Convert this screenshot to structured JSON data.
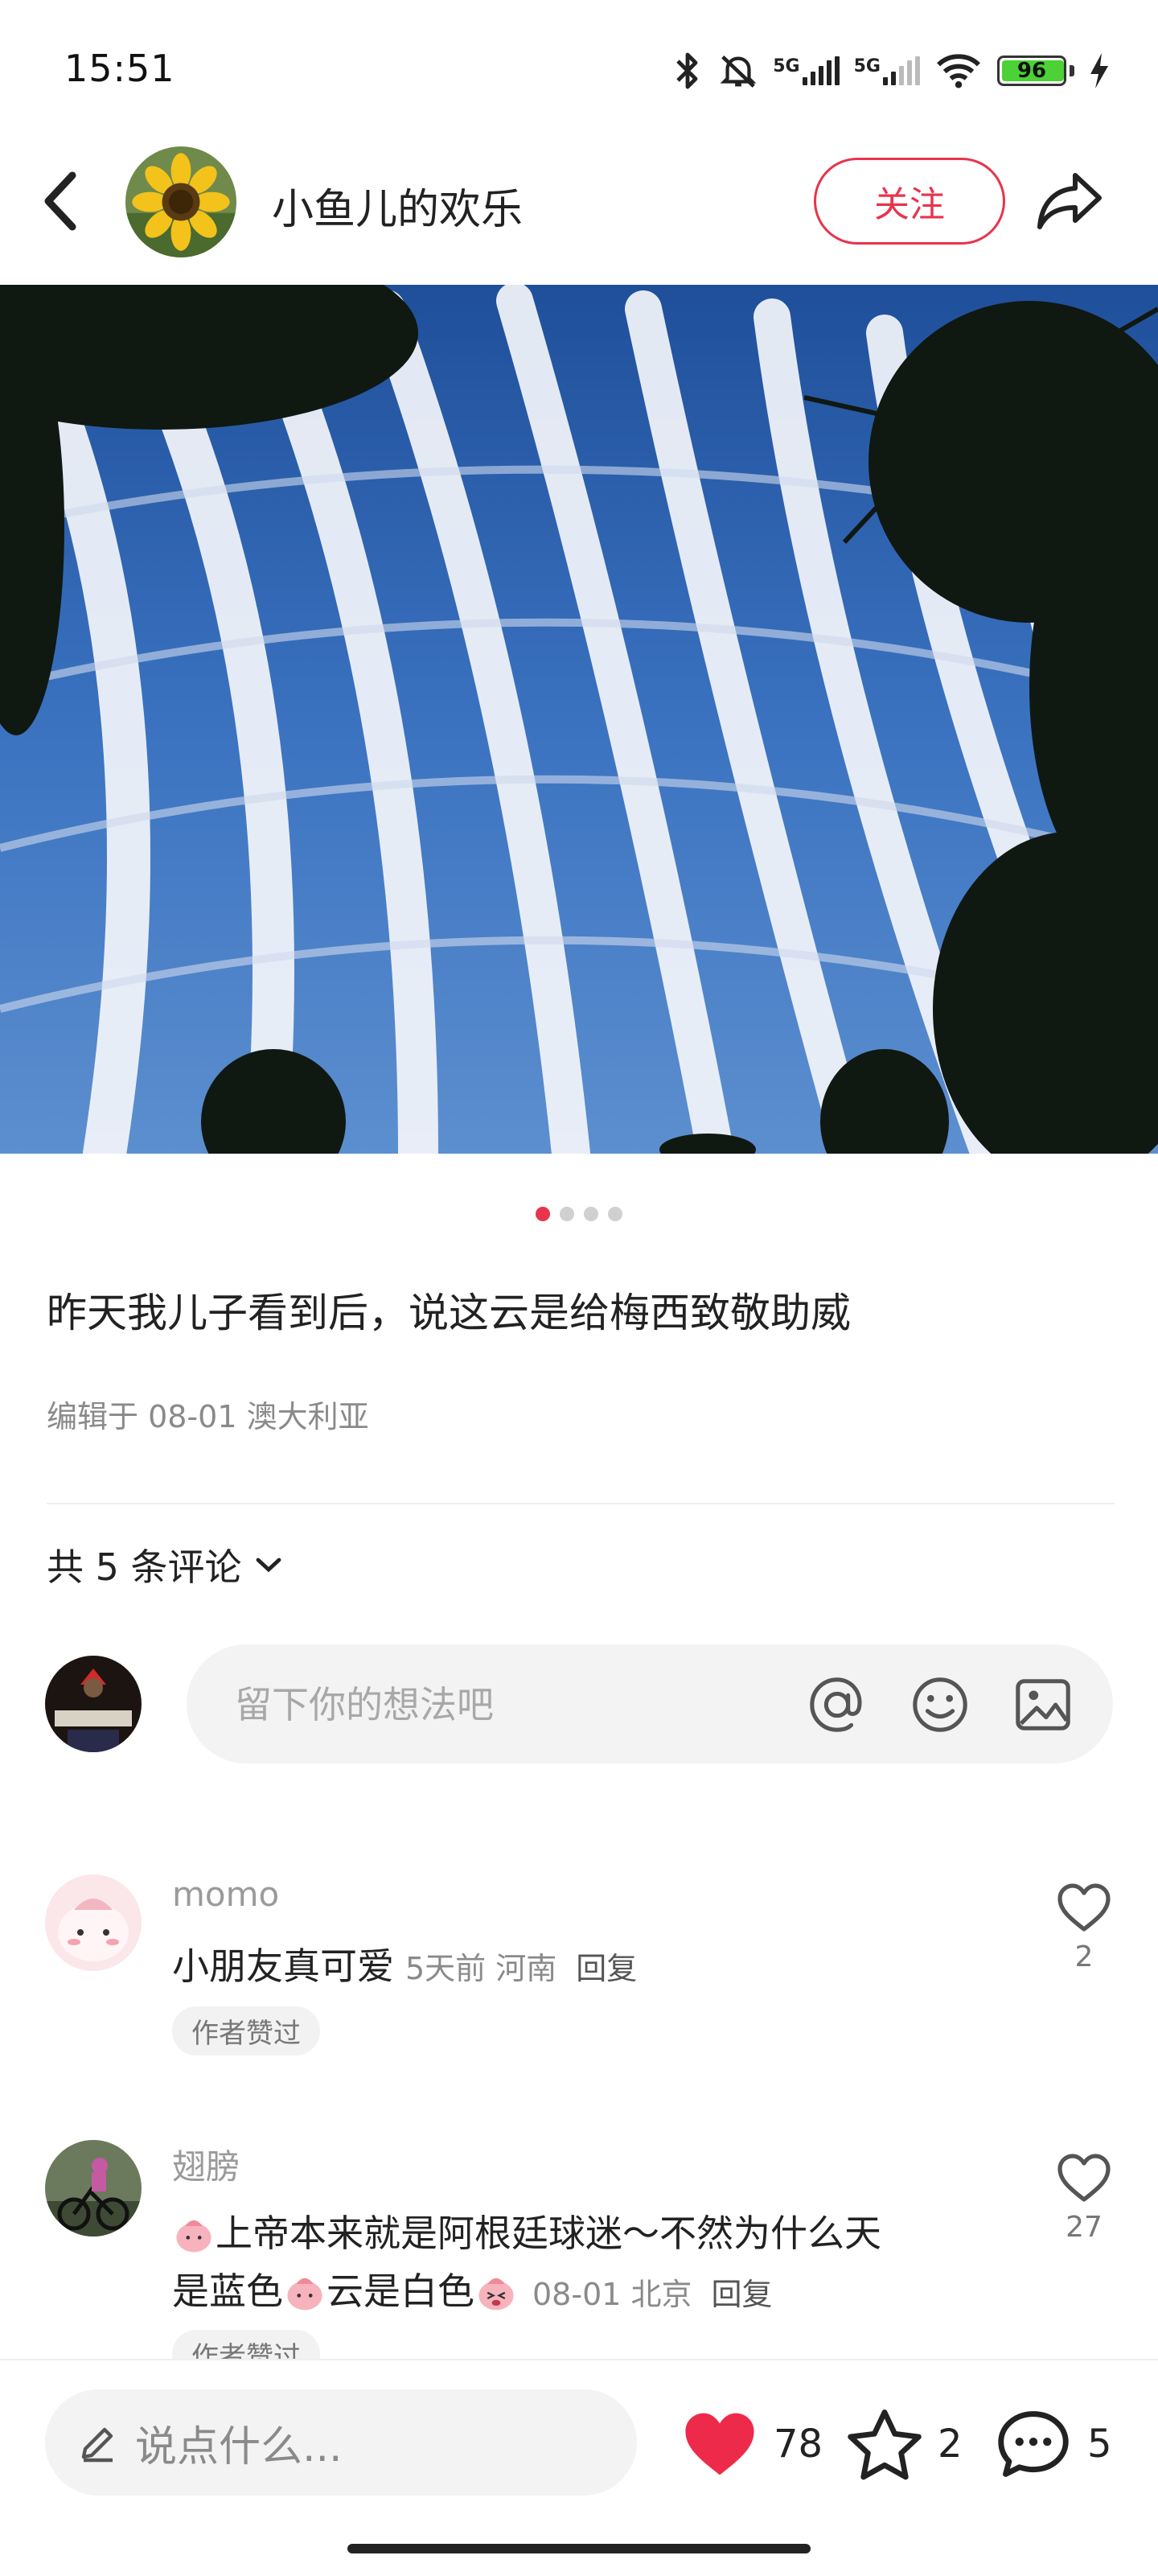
{
  "status_bar": {
    "time": "15:51",
    "battery": "96",
    "network_1": "5G",
    "network_2": "5G"
  },
  "header": {
    "author_name": "小鱼儿的欢乐",
    "follow_label": "关注"
  },
  "post": {
    "image_count": 4,
    "active_image": 1,
    "text": "昨天我儿子看到后，说这云是给梅西致敬助威",
    "meta": "编辑于  08-01 澳大利亚"
  },
  "comments_section": {
    "count_label": "共 5 条评论",
    "input_placeholder": "留下你的想法吧"
  },
  "comments": [
    {
      "user": "momo",
      "text": "小朋友真可爱",
      "meta": "5天前 河南",
      "reply_label": "回复",
      "tag": "作者赞过",
      "likes": "2"
    },
    {
      "user": "翅膀",
      "text_line1": "上帝本来就是阿根廷球迷～不然为什么天",
      "text_line2_a": "是蓝色",
      "text_line2_b": "云是白色",
      "meta": "08-01 北京",
      "reply_label": "回复",
      "tag": "作者赞过",
      "likes": "27"
    }
  ],
  "bottom_bar": {
    "say_placeholder": "说点什么...",
    "likes": "78",
    "favorites": "2",
    "comments": "5"
  },
  "colors": {
    "accent": "#e8344c",
    "heart": "#ee2a4a",
    "sky": "#3f74c4"
  }
}
